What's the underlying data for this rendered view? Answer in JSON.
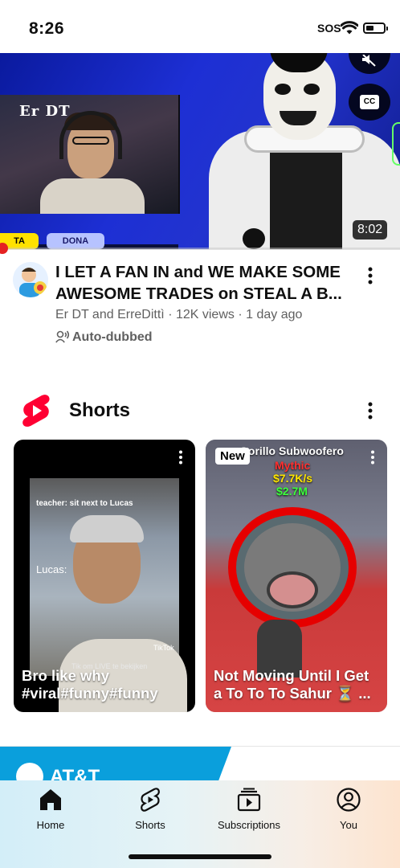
{
  "status_bar": {
    "time": "8:26",
    "sos": "SOS",
    "battery_level": 0.45
  },
  "video": {
    "duration": "8:02",
    "overlay_cam_logo": "Er DT",
    "banner_left": "TA",
    "banner_right": "DONA",
    "title": "I LET A FAN IN and WE MAKE SOME AWESOME TRADES on STEAL A B...",
    "channel_meta": "Er DT and ErreDittì · 12K views · 1 day ago",
    "auto_dubbed": "Auto-dubbed",
    "cc_label": "CC",
    "progress": 0.0
  },
  "shorts": {
    "heading": "Shorts",
    "items": [
      {
        "title": "Bro like why #viral#funny#funny",
        "overlay_caption": "teacher: sit next to Lucas",
        "overlay_caption_2": "Lucas:",
        "overlay_live": "Tik om LIVE te bekijken",
        "overlay_brand": "TikTok"
      },
      {
        "title": "Not Moving Until I Get a To To To Sahur ⏳ ...",
        "badge": "New",
        "overlay_name": "Gorillo Subwoofero",
        "overlay_rarity": "Mythic",
        "overlay_rate": "$7.7K/s",
        "overlay_price": "$2.7M"
      }
    ]
  },
  "ad": {
    "brand": "AT&T"
  },
  "tabs": [
    {
      "label": "Home",
      "icon": "home-icon",
      "active": true
    },
    {
      "label": "Shorts",
      "icon": "shorts-icon",
      "active": false
    },
    {
      "label": "Subscriptions",
      "icon": "subscriptions-icon",
      "active": false
    },
    {
      "label": "You",
      "icon": "account-icon",
      "active": false
    }
  ],
  "colors": {
    "accent_red": "#ff0033",
    "text_primary": "#0f0f0f",
    "text_secondary": "#606060"
  }
}
